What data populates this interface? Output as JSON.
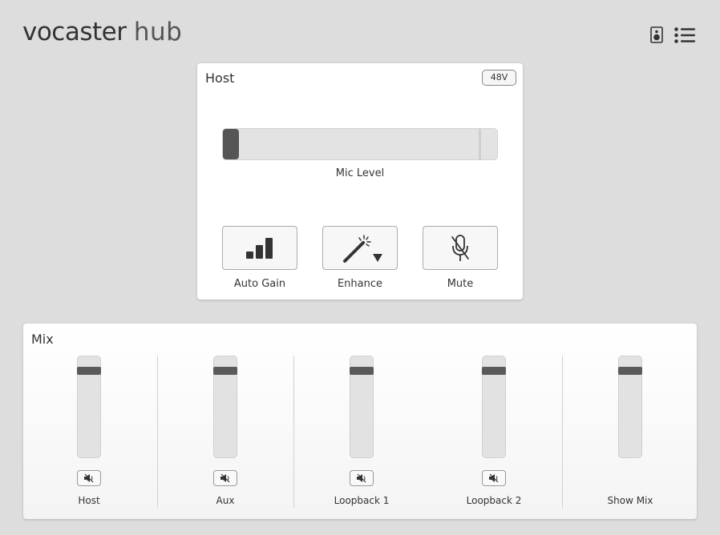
{
  "header": {
    "logo_word1": "vocaster",
    "logo_word2": "hub",
    "icons": [
      "speaker-icon",
      "menu-list-icon"
    ]
  },
  "host": {
    "title": "Host",
    "phantom_label": "48V",
    "mic_level_label": "Mic Level",
    "mic_level_value": 0,
    "buttons": [
      {
        "label": "Auto Gain",
        "icon": "bar-chart-icon"
      },
      {
        "label": "Enhance",
        "icon": "magic-wand-icon"
      },
      {
        "label": "Mute",
        "icon": "mic-off-icon"
      }
    ]
  },
  "mix": {
    "title": "Mix",
    "channels": [
      {
        "label": "Host",
        "has_mute": true
      },
      {
        "label": "Aux",
        "has_mute": true
      },
      {
        "label": "Loopback 1",
        "has_mute": true
      },
      {
        "label": "Loopback 2",
        "has_mute": true
      },
      {
        "label": "Show Mix",
        "has_mute": false
      }
    ]
  },
  "colors": {
    "background": "#dddddd",
    "card": "#ffffff",
    "thumb": "#555555",
    "text": "#333333"
  }
}
